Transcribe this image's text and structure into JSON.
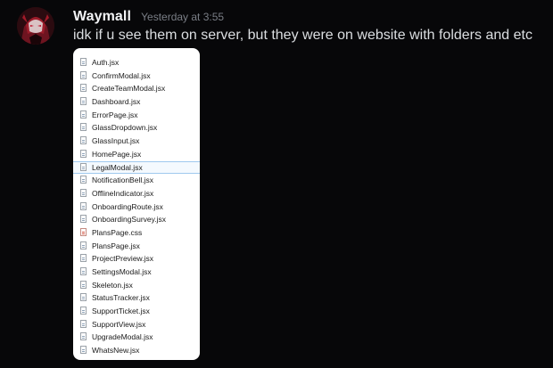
{
  "message": {
    "username": "Waymall",
    "timestamp": "Yesterday at 3:55",
    "text": "idk if u see them on server, but they were on website with folders and etc"
  },
  "attachment": {
    "files": [
      {
        "name": "Auth.jsx",
        "icon": "file-icon"
      },
      {
        "name": "ConfirmModal.jsx",
        "icon": "file-icon"
      },
      {
        "name": "CreateTeamModal.jsx",
        "icon": "file-icon"
      },
      {
        "name": "Dashboard.jsx",
        "icon": "file-icon"
      },
      {
        "name": "ErrorPage.jsx",
        "icon": "file-icon"
      },
      {
        "name": "GlassDropdown.jsx",
        "icon": "file-icon"
      },
      {
        "name": "GlassInput.jsx",
        "icon": "file-icon"
      },
      {
        "name": "HomePage.jsx",
        "icon": "file-icon"
      },
      {
        "name": "LegalModal.jsx",
        "icon": "file-icon",
        "selected": true
      },
      {
        "name": "NotificationBell.jsx",
        "icon": "file-icon"
      },
      {
        "name": "OfflineIndicator.jsx",
        "icon": "file-icon"
      },
      {
        "name": "OnboardingRoute.jsx",
        "icon": "file-icon"
      },
      {
        "name": "OnboardingSurvey.jsx",
        "icon": "file-icon"
      },
      {
        "name": "PlansPage.css",
        "icon": "css-file-icon"
      },
      {
        "name": "PlansPage.jsx",
        "icon": "file-icon"
      },
      {
        "name": "ProjectPreview.jsx",
        "icon": "file-icon"
      },
      {
        "name": "SettingsModal.jsx",
        "icon": "file-icon"
      },
      {
        "name": "Skeleton.jsx",
        "icon": "file-icon"
      },
      {
        "name": "StatusTracker.jsx",
        "icon": "file-icon"
      },
      {
        "name": "SupportTicket.jsx",
        "icon": "file-icon"
      },
      {
        "name": "SupportView.jsx",
        "icon": "file-icon"
      },
      {
        "name": "UpgradeModal.jsx",
        "icon": "file-icon"
      },
      {
        "name": "WhatsNew.jsx",
        "icon": "file-icon"
      }
    ]
  },
  "colors": {
    "background": "#070709",
    "username": "#f2f3f5",
    "timestamp": "#7a7e86",
    "message_text": "#dbdee1",
    "attachment_bg": "#ffffff",
    "selection_border": "#9fc9ee"
  }
}
